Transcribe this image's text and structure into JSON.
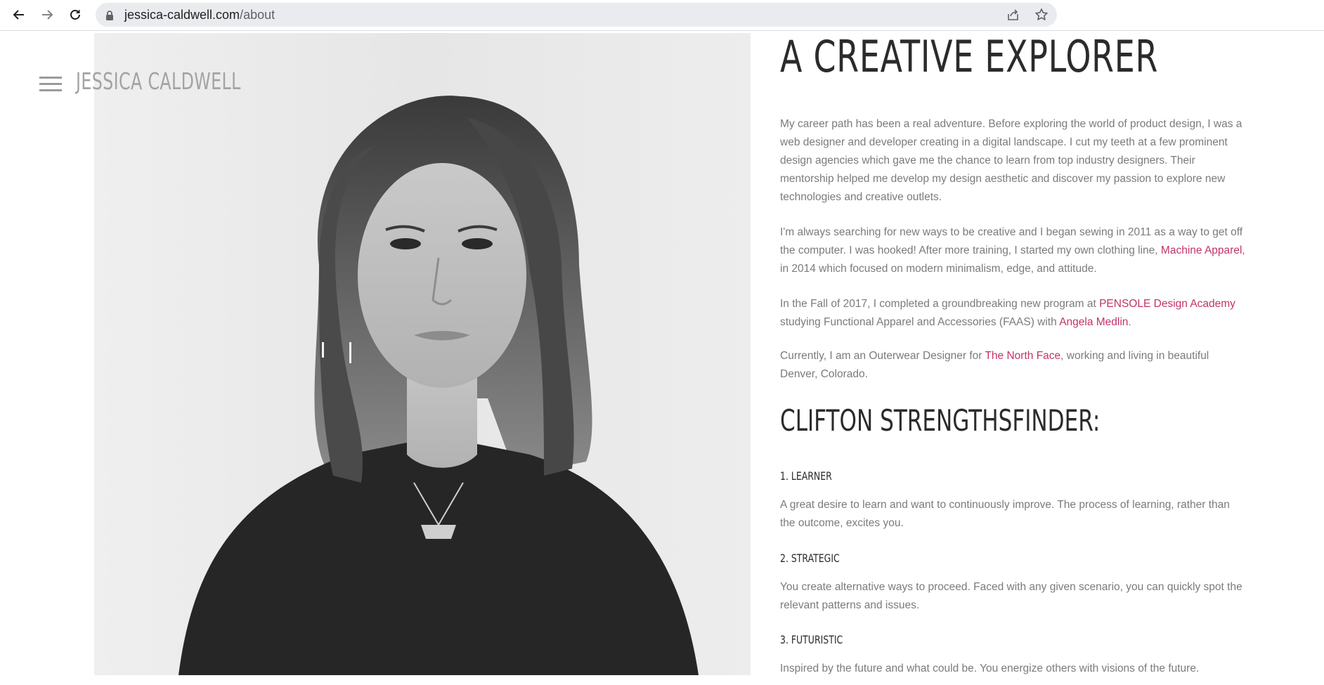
{
  "browser": {
    "url_host": "jessica-caldwell.com",
    "url_path": "/about",
    "icons": [
      "back-icon",
      "forward-icon",
      "reload-icon",
      "lock-icon",
      "share-icon",
      "star-icon"
    ]
  },
  "site": {
    "title": "JESSICA CALDWELL",
    "menu_icon": "hamburger-icon"
  },
  "about": {
    "heading": "A CREATIVE EXPLORER",
    "p1": "My career path has been a real adventure. Before exploring the world of product design, I was a web designer and developer creating in a digital landscape. I cut my teeth at a few prominent design agencies which gave me the chance to learn from top industry designers. Their mentorship helped me develop my design aesthetic and discover my passion to explore new technologies and creative outlets.",
    "p2": {
      "before": "I'm always searching for new ways to be creative and I began sewing in 2011 as a way to get off the computer. I was hooked! After more training, I started my own clothing line, ",
      "link": "Machine Apparel",
      "after": ", in 2014 which focused on modern minimalism, edge, and attitude."
    },
    "p3": {
      "before": "In the Fall of 2017, I completed a groundbreaking new program at ",
      "link1": "PENSOLE Design Academy",
      "middle": " studying Functional Apparel and Accessories (FAAS) with ",
      "link2": "Angela Medlin",
      "after": "."
    },
    "p4": {
      "before": "Currently, I am an Outerwear Designer for ",
      "link": "The North Face",
      "after": ", working and living in beautiful Denver, Colorado."
    }
  },
  "strengths": {
    "heading": "CLIFTON STRENGTHSFINDER:",
    "items": [
      {
        "title": "1. LEARNER",
        "text": "A great desire to learn and want to continuously improve. The process of learning, rather than the outcome, excites you."
      },
      {
        "title": "2. STRATEGIC",
        "text": "You create alternative ways to proceed. Faced with any given scenario, you can quickly spot the relevant patterns and issues."
      },
      {
        "title": "3. FUTURISTIC",
        "text": "Inspired by the future and what could be. You energize others with visions of the future."
      }
    ]
  },
  "colors": {
    "link": "#c2336a",
    "body_text": "#7b7b7b",
    "heading": "#2b2b2b"
  }
}
